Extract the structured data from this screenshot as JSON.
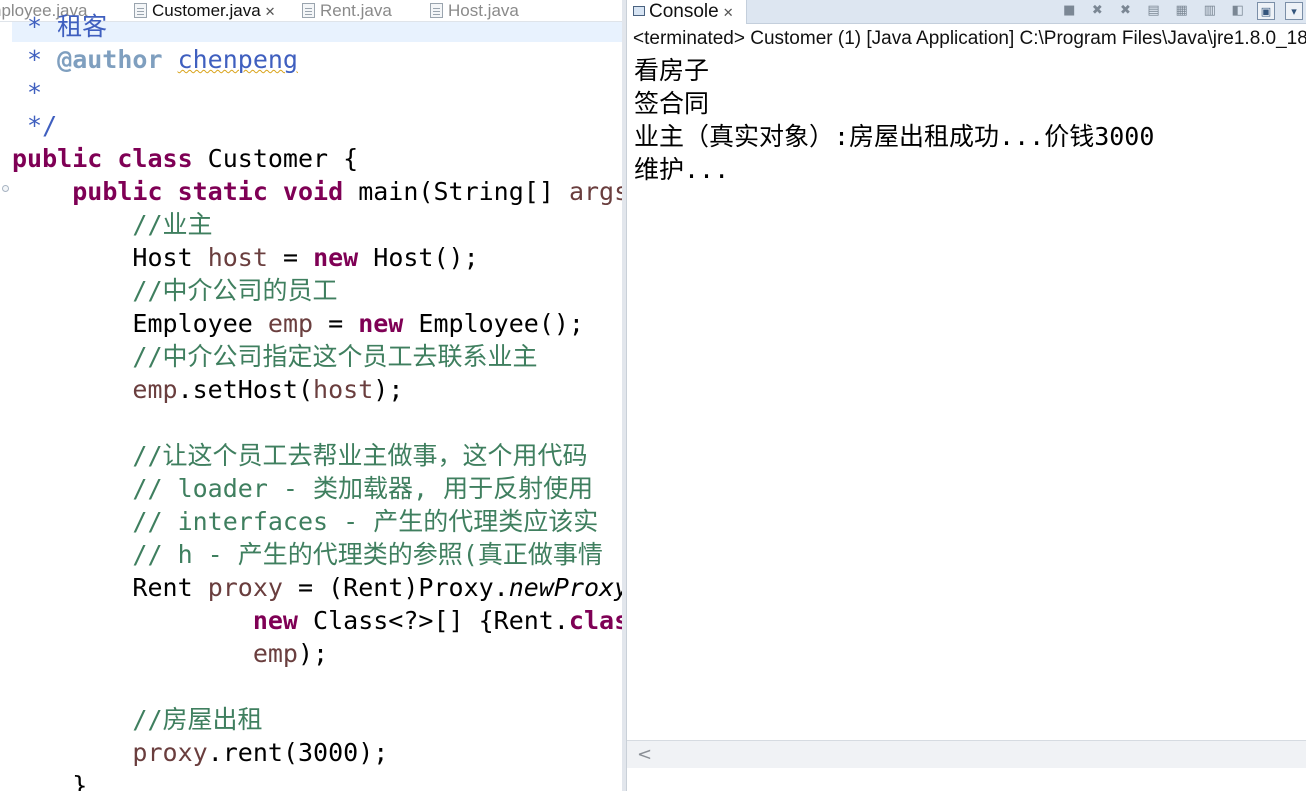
{
  "editor": {
    "tabs": [
      {
        "label": "nployee.java",
        "active": false
      },
      {
        "label": "Customer.java",
        "active": true,
        "close": "✕"
      },
      {
        "label": "Rent.java",
        "active": false
      },
      {
        "label": "Host.java",
        "active": false
      }
    ],
    "code": {
      "l0_partial": " * 租客",
      "l1_star": " * ",
      "l1_tag": "@author",
      "l1_name": "chenpeng",
      "l2": " *",
      "l3": " */",
      "l4_kw": "public class",
      "l4_rest": " Customer {",
      "l5_kw": "public static void",
      "l5_rest": " main(String[] ",
      "l5_args": "args",
      "l6": "//业主",
      "l7_a": "Host ",
      "l7_var": "host",
      "l7_b": " = ",
      "l7_new": "new",
      "l7_c": " Host();",
      "l8": "//中介公司的员工",
      "l9_a": "Employee ",
      "l9_var": "emp",
      "l9_b": " = ",
      "l9_new": "new",
      "l9_c": " Employee();",
      "l10": "//中介公司指定这个员工去联系业主",
      "l11_var": "emp",
      "l11_b": ".setHost(",
      "l11_var2": "host",
      "l11_c": ");",
      "l12": "//让这个员工去帮业主做事，这个用代码",
      "l13": "// loader - 类加载器, 用于反射使用",
      "l14": "// interfaces - 产生的代理类应该实",
      "l15": "// h - 产生的代理类的参照(真正做事情",
      "l16_a": "Rent ",
      "l16_var": "proxy",
      "l16_b": " = (Rent)Proxy.",
      "l16_it": "newProxy",
      "l17_new": "new",
      "l17_b": " Class<?>[] {Rent.",
      "l17_kw": "clas",
      "l18_var": "emp",
      "l18_b": ");",
      "l19": "//房屋出租",
      "l20_var": "proxy",
      "l20_b": ".rent(3000);",
      "l21": "}"
    }
  },
  "console": {
    "tab_label": "Console",
    "tab_close": "✕",
    "toolbar_icons": [
      "terminate-icon",
      "remove-launch-icon",
      "remove-all-icon",
      "clear-console-icon",
      "scroll-lock-icon",
      "word-wrap-icon",
      "pin-console-icon",
      "display-selected-icon",
      "open-console-icon"
    ],
    "terminated_line": "<terminated> Customer (1) [Java Application] C:\\Program Files\\Java\\jre1.8.0_18",
    "output": [
      "看房子",
      "签合同",
      "业主（真实对象）:房屋出租成功...价钱3000",
      "维护..."
    ],
    "scroll_left": "<"
  }
}
